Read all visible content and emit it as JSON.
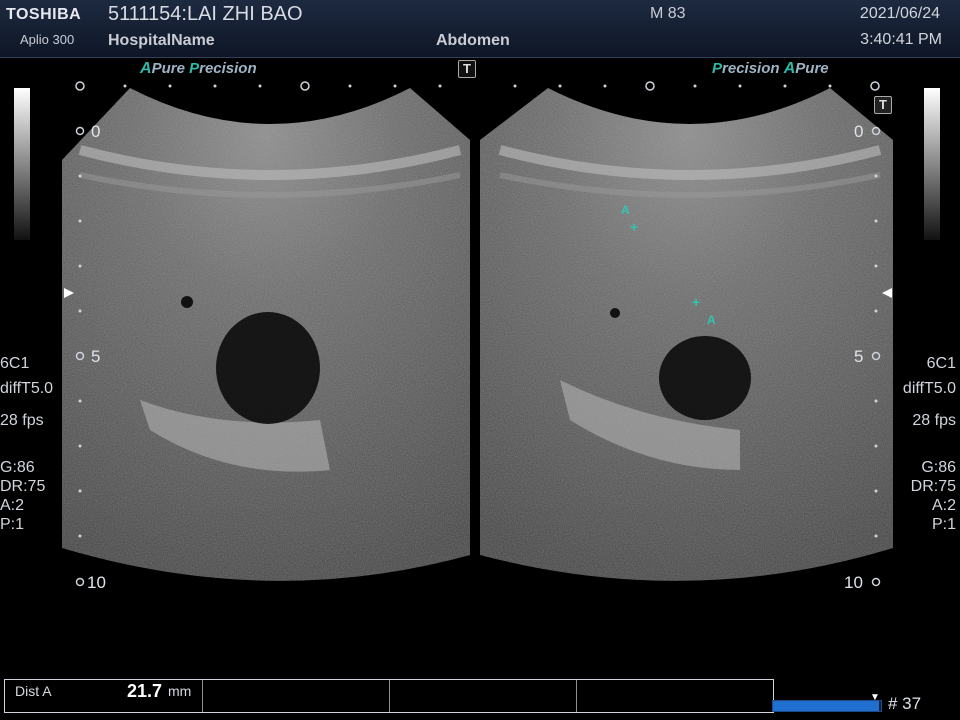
{
  "header": {
    "brand": "TOSHIBA",
    "model": "Aplio 300",
    "patient": "5111154:LAI ZHI BAO",
    "hospital": "HospitalName",
    "exam": "Abdomen",
    "age": "M 83",
    "date": "2021/06/24",
    "time": "3:40:41 PM"
  },
  "left_panel": {
    "probe": "6C1",
    "filter": "diffT5.0",
    "fps": "28 fps",
    "gain": "G:86",
    "dr": "DR:75",
    "a": "A:2",
    "p": "P:1",
    "preset_a": "A",
    "preset_pure": "Pure",
    "preset_p": "P",
    "preset_recision": "recision"
  },
  "right_panel": {
    "probe": "6C1",
    "filter": "diffT5.0",
    "fps": "28 fps",
    "gain": "G:86",
    "dr": "DR:75",
    "a": "A:2",
    "p": "P:1",
    "preset_p": "P",
    "preset_recision": "recision",
    "preset_a": "A",
    "preset_pure": "Pure"
  },
  "depth": {
    "d0": "0",
    "d5": "5",
    "d10": "10"
  },
  "caliper": {
    "label": "A",
    "plus": "+"
  },
  "badge": "T",
  "measure": {
    "name": "Dist A",
    "value": "21.7",
    "unit": "mm"
  },
  "cine": {
    "frame": "# 37",
    "progress": 0.98
  },
  "colors": {
    "accent": "#2fb9a8",
    "header_bg": "#14203a",
    "progress": "#1e6fd0"
  }
}
